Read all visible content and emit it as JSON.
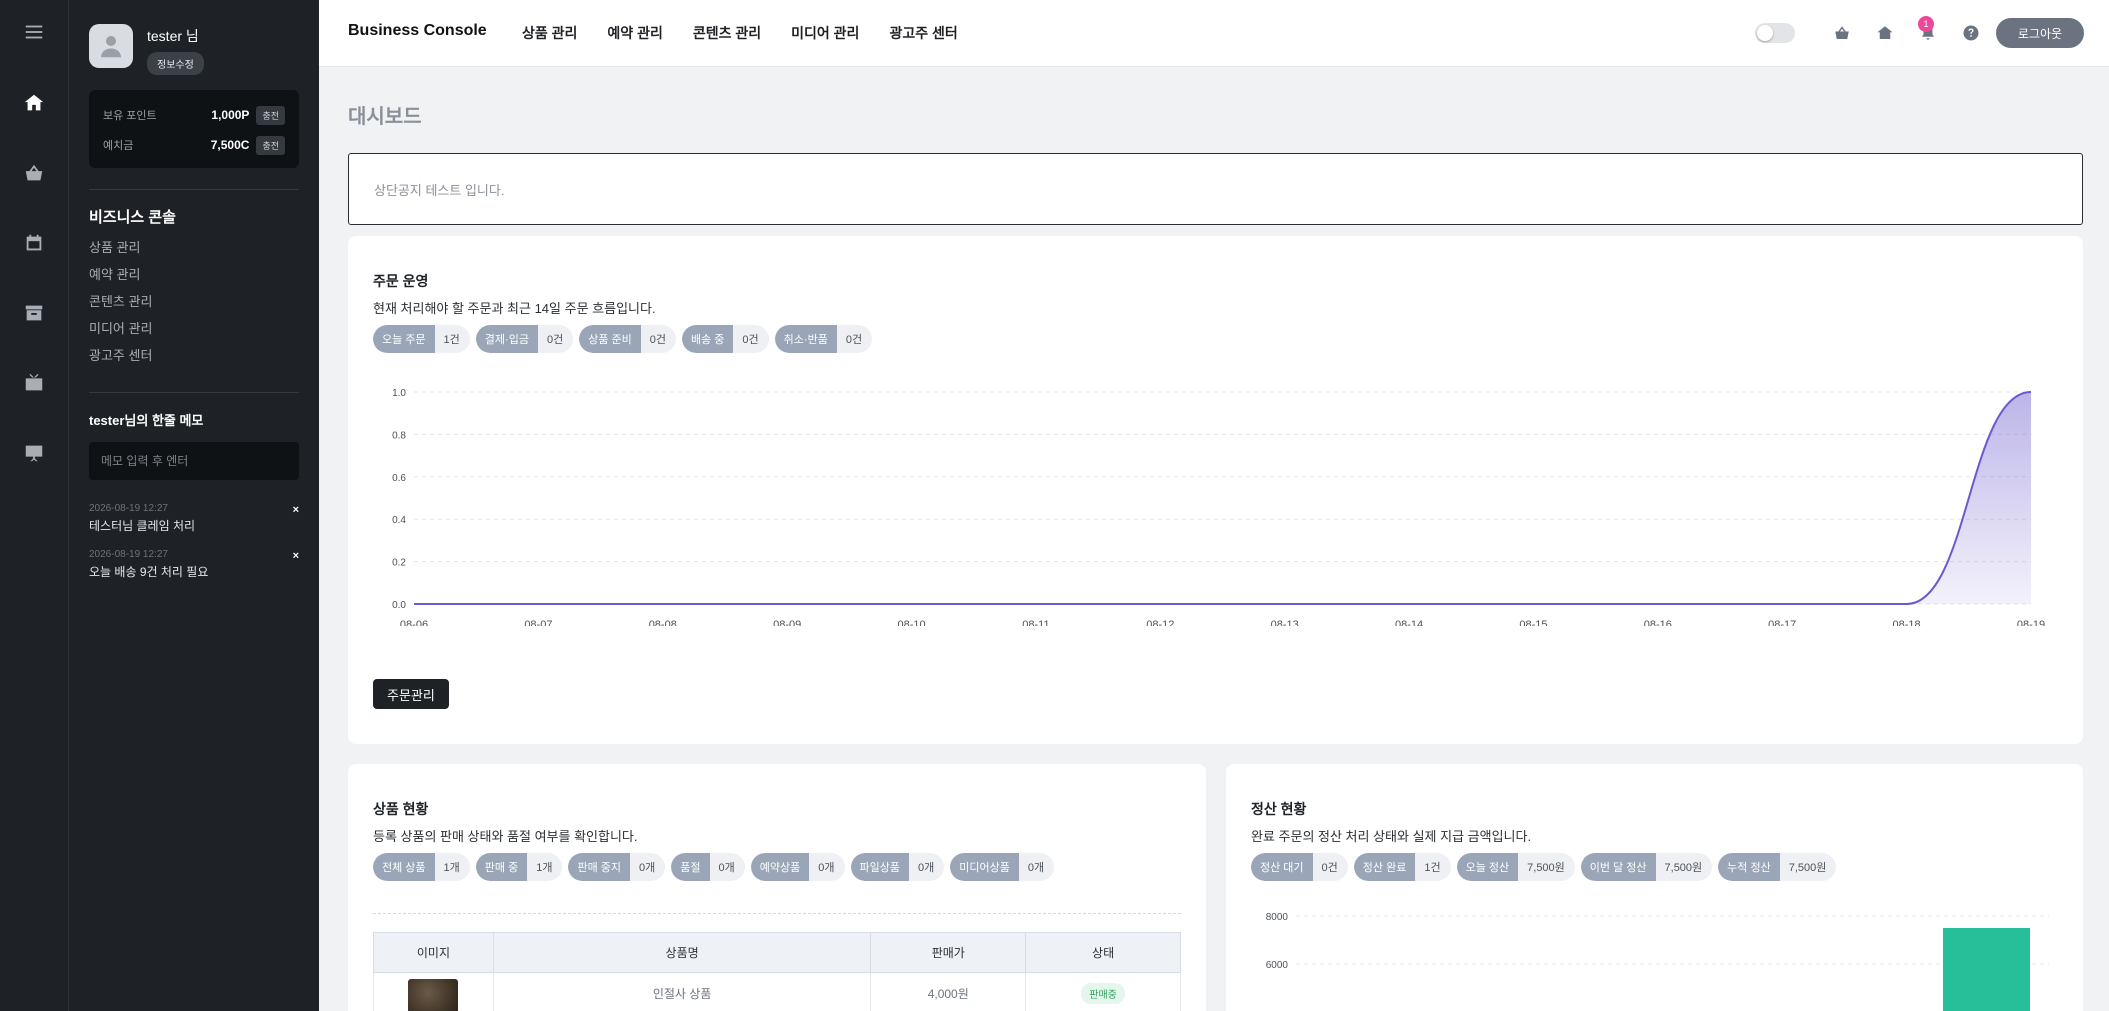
{
  "header": {
    "brand": "Business Console",
    "nav": [
      "상품 관리",
      "예약 관리",
      "콘텐츠 관리",
      "미디어 관리",
      "광고주 센터"
    ],
    "notification_count": "1",
    "logout_label": "로그아웃"
  },
  "profile": {
    "name": "tester 님",
    "edit_label": "정보수정"
  },
  "wallet": {
    "points_label": "보유 포인트",
    "points_value": "1,000P",
    "deposit_label": "예치금",
    "deposit_value": "7,500C",
    "charge_label": "충전"
  },
  "sidebar": {
    "title": "비즈니스 콘솔",
    "items": [
      "상품 관리",
      "예약 관리",
      "콘텐츠 관리",
      "미디어 관리",
      "광고주 센터"
    ]
  },
  "memo": {
    "title": "tester님의 한줄 메모",
    "placeholder": "메모 입력 후 엔터",
    "delete_icon": "×",
    "items": [
      {
        "date": "2026-08-19 12:27",
        "text": "테스터님 클레임 처리"
      },
      {
        "date": "2026-08-19 12:27",
        "text": "오늘 배송 9건 처리 필요"
      }
    ]
  },
  "page": {
    "title": "대시보드",
    "notice": "상단공지 테스트 입니다."
  },
  "orders": {
    "title": "주문 운영",
    "desc": "현재 처리해야 할 주문과 최근 14일 주문 흐름입니다.",
    "chips": [
      {
        "key": "오늘 주문",
        "value": "1건"
      },
      {
        "key": "결제·입금",
        "value": "0건"
      },
      {
        "key": "상품 준비",
        "value": "0건"
      },
      {
        "key": "배송 중",
        "value": "0건"
      },
      {
        "key": "취소·반품",
        "value": "0건"
      }
    ],
    "button_label": "주문관리"
  },
  "products": {
    "title": "상품 현황",
    "desc": "등록 상품의 판매 상태와 품절 여부를 확인합니다.",
    "chips": [
      {
        "key": "전체 상품",
        "value": "1개"
      },
      {
        "key": "판매 중",
        "value": "1개"
      },
      {
        "key": "판매 중지",
        "value": "0개"
      },
      {
        "key": "품절",
        "value": "0개"
      },
      {
        "key": "예약상품",
        "value": "0개"
      },
      {
        "key": "파일상품",
        "value": "0개"
      },
      {
        "key": "미디어상품",
        "value": "0개"
      }
    ],
    "columns": [
      "이미지",
      "상품명",
      "판매가",
      "상태"
    ],
    "rows": [
      {
        "name": "인절사 상품",
        "price": "4,000원",
        "status": "판매중"
      }
    ]
  },
  "settlement": {
    "title": "정산 현황",
    "desc": "완료 주문의 정산 처리 상태와 실제 지급 금액입니다.",
    "chips": [
      {
        "key": "정산 대기",
        "value": "0건"
      },
      {
        "key": "정산 완료",
        "value": "1건"
      },
      {
        "key": "오늘 정산",
        "value": "7,500원"
      },
      {
        "key": "이번 달 정산",
        "value": "7,500원"
      },
      {
        "key": "누적 정산",
        "value": "7,500원"
      }
    ]
  },
  "chart_data": [
    {
      "type": "area",
      "x": [
        "08-06",
        "08-07",
        "08-08",
        "08-09",
        "08-10",
        "08-11",
        "08-12",
        "08-13",
        "08-14",
        "08-15",
        "08-16",
        "08-17",
        "08-18",
        "08-19"
      ],
      "values": [
        0,
        0,
        0,
        0,
        0,
        0,
        0,
        0,
        0,
        0,
        0,
        0,
        0,
        1
      ],
      "ylim": [
        0,
        1.0
      ],
      "yticks": [
        "0.0",
        "0.2",
        "0.4",
        "0.6",
        "0.8",
        "1.0"
      ],
      "grid": true,
      "color": "#6a5acd"
    },
    {
      "type": "bar",
      "yticks": [
        "8000",
        "6000"
      ],
      "values": [
        7500
      ],
      "ylim": [
        0,
        8000
      ],
      "grid": true,
      "color": "#26bf9a"
    }
  ]
}
